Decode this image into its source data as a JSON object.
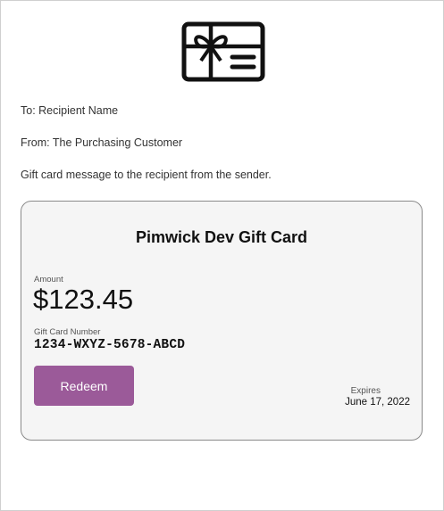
{
  "header": {
    "icon": "gift-card-icon"
  },
  "to_line": "To: Recipient Name",
  "from_line": "From: The Purchasing Customer",
  "message_line": "Gift card message to the recipient from the sender.",
  "card": {
    "title": "Pimwick Dev Gift Card",
    "amount_label": "Amount",
    "amount_value": "$123.45",
    "number_label": "Gift Card Number",
    "number_value": "1234-WXYZ-5678-ABCD",
    "redeem_label": "Redeem",
    "expires_label": "Expires",
    "expires_value": "June 17, 2022"
  },
  "colors": {
    "accent": "#9b5a99",
    "card_background": "#f5f5f5",
    "card_border": "#8a8a8a"
  }
}
